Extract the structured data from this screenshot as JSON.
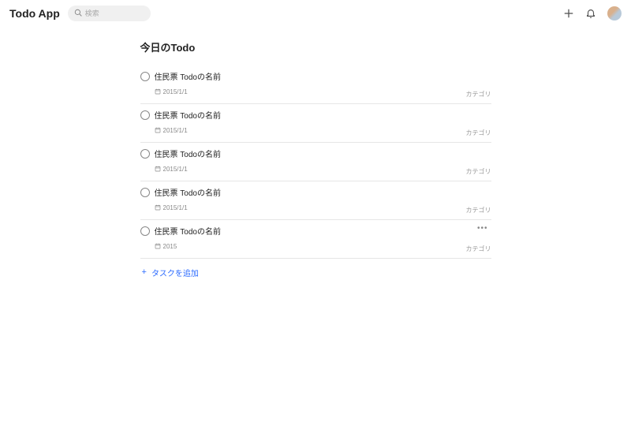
{
  "header": {
    "app_title": "Todo App",
    "search_placeholder": "検索"
  },
  "main": {
    "title": "今日のTodo",
    "add_task_label": "タスクを追加",
    "todos": [
      {
        "title": "住民票 Todoの名前",
        "date": "2015/1/1",
        "category": "カテゴリ",
        "more": false
      },
      {
        "title": "住民票 Todoの名前",
        "date": "2015/1/1",
        "category": "カテゴリ",
        "more": false
      },
      {
        "title": "住民票 Todoの名前",
        "date": "2015/1/1",
        "category": "カテゴリ",
        "more": false
      },
      {
        "title": "住民票 Todoの名前",
        "date": "2015/1/1",
        "category": "カテゴリ",
        "more": false
      },
      {
        "title": "住民票 Todoの名前",
        "date": "2015",
        "category": "カテゴリ",
        "more": true
      }
    ]
  }
}
